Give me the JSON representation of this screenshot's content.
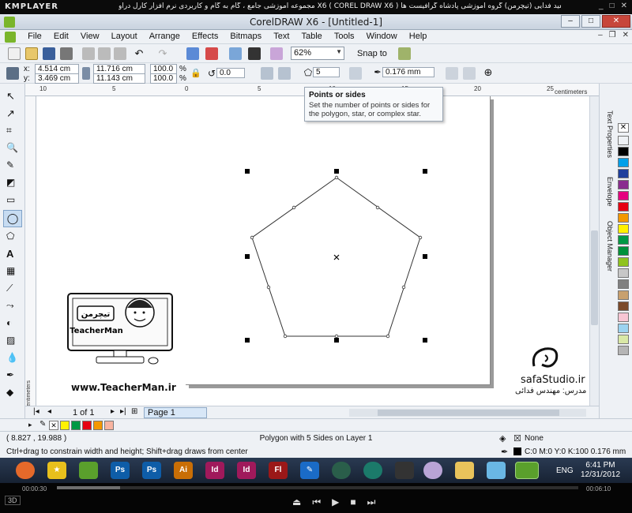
{
  "km_player": {
    "logo": "KMPLAYER",
    "title": "مجموعه آموزشی جامع ، گام به گام و کاربردی نرم افزار کارل دراو X6 ( COREL DRAW X6 )  مدرس : سعید فدایی (تیچرمن) گروه آموزشی پادشاه گرافیست ها",
    "elapsed": "00:00:30",
    "total": "00:06:10"
  },
  "app": {
    "title": "CorelDRAW X6 - [Untitled-1]",
    "menu": [
      "File",
      "Edit",
      "View",
      "Layout",
      "Arrange",
      "Effects",
      "Bitmaps",
      "Text",
      "Table",
      "Tools",
      "Window",
      "Help"
    ]
  },
  "toolbar": {
    "zoom": "62%",
    "snap_label": "Snap to"
  },
  "property_bar": {
    "x": "4.514 cm",
    "y": "3.469 cm",
    "width": "11.716 cm",
    "height": "11.143 cm",
    "scale_x": "100.0",
    "scale_y": "100.0",
    "percent": "%",
    "rotation": "0.0",
    "points_sides": "5",
    "outline_width": "0.176 mm",
    "x_label": "x:",
    "y_label": "y:"
  },
  "tooltip": {
    "title": "Points or sides",
    "body": "Set the number of points or sides for the polygon, star, or complex star."
  },
  "ruler": {
    "unit": "centimeters",
    "top_ticks": [
      "10",
      "5",
      "0",
      "5",
      "10",
      "15",
      "20",
      "25"
    ],
    "left_unit": "centimeters"
  },
  "dockers": [
    "Text Properties",
    "Envelope",
    "Object Manager"
  ],
  "page_nav": {
    "count": "1 of 1",
    "tab": "Page 1"
  },
  "status": {
    "coords": "( 8.827 , 19.988 )",
    "object": "Polygon with 5 Sides on Layer 1",
    "hint": "Ctrl+drag to constrain width and height; Shift+drag draws from center",
    "fill": "None",
    "outline": "C:0 M:0 Y:0 K:100  0.176 mm"
  },
  "taskbar": {
    "lang": "ENG",
    "time": "6:41 PM",
    "date": "12/31/2012",
    "apps": [
      "firefox-icon",
      "star-icon",
      "corel-icon",
      "photoshop-icon",
      "photoshop-icon",
      "illustrator-icon",
      "indesign-icon",
      "indesign-icon",
      "flash-icon",
      "pen-icon",
      "app-icon",
      "app-icon",
      "app-icon",
      "disc-icon",
      "folder-icon",
      "app-icon",
      "corel-icon"
    ],
    "app_labels": [
      "",
      "",
      "",
      "Ps",
      "Ps",
      "Ai",
      "Id",
      "Id",
      "Fl",
      "",
      "",
      "",
      "",
      "",
      "",
      "",
      ""
    ]
  },
  "artwork": {
    "teacher_logo_text": "تیچرمن",
    "teacher_name": "TeacherMan",
    "teacher_url": "www.TeacherMan.ir",
    "safa": "safaStudio.ir",
    "safa_sub": "مدرس: مهندس فدائی"
  },
  "colors": {
    "palette": [
      "#ffffff",
      "#000000",
      "#00a0e9",
      "#1e3f9c",
      "#8a2d8f",
      "#e5007f",
      "#e60012",
      "#f39800",
      "#fff100",
      "#009944",
      "#00913a",
      "#8fc31f",
      "#c7c7c7",
      "#808080"
    ],
    "bottom_swatches": [
      "#fff100",
      "#009944",
      "#e60012",
      "#f39800",
      "#f8b4a0"
    ]
  }
}
